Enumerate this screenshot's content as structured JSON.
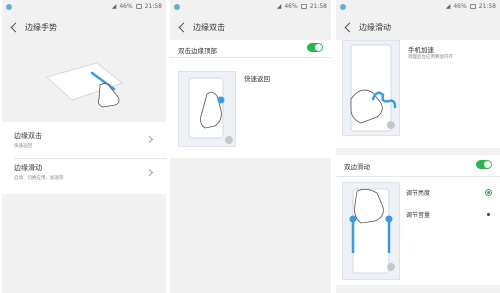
{
  "colors": {
    "accent": "#2eb552",
    "blue": "#3b9ae1",
    "background": "#f1f1f1"
  },
  "panels": [
    {
      "status": {
        "battery": "46%",
        "time": "21:58"
      },
      "title": "边缘手势",
      "items": [
        {
          "label": "边缘双击",
          "sub": "快速返回"
        },
        {
          "label": "边缘滑动",
          "sub": "启动、切换应用、加速等"
        }
      ]
    },
    {
      "status": {
        "battery": "46%",
        "time": "21:58"
      },
      "title": "边缘双击",
      "toggle_label": "双击边缘顶部",
      "toggle_on": true,
      "feature": "快速返回"
    },
    {
      "status": {
        "battery": "46%",
        "time": "21:58"
      },
      "title": "边缘滑动",
      "feature": {
        "title": "手机加速",
        "sub": "调理后台应用释放内存"
      },
      "toggle_label": "双边滑动",
      "toggle_on": true,
      "options": [
        {
          "label": "调节亮度",
          "selected": true
        },
        {
          "label": "调节音量",
          "selected": false
        }
      ]
    }
  ]
}
